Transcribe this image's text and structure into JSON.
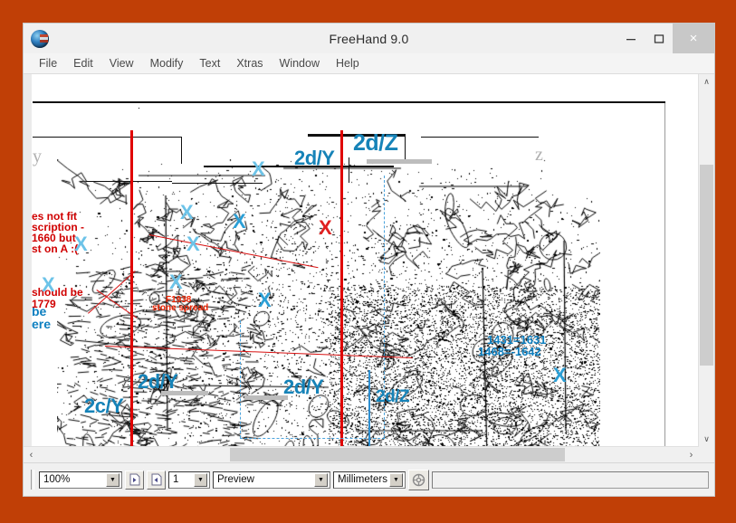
{
  "window": {
    "title": "FreeHand 9.0",
    "app_icon_name": "freehand-app-icon",
    "minimize_label": "–",
    "maximize_label": "❑",
    "close_label": "×"
  },
  "menu": {
    "items": [
      {
        "label": "File"
      },
      {
        "label": "Edit"
      },
      {
        "label": "View"
      },
      {
        "label": "Modify"
      },
      {
        "label": "Text"
      },
      {
        "label": "Xtras"
      },
      {
        "label": "Window"
      },
      {
        "label": "Help"
      }
    ]
  },
  "status_bar": {
    "zoom": {
      "value": "100%",
      "arrow": "▼"
    },
    "prev_page_icon": "previous-page-icon",
    "next_page_icon": "next-page-icon",
    "page": {
      "value": "1",
      "arrow": "▼"
    },
    "view_mode": {
      "value": "Preview",
      "arrow": "▼"
    },
    "units": {
      "value": "Millimeters",
      "arrow": "▼"
    },
    "animate_icon": "animation-wheel-icon",
    "message": ""
  },
  "scrollbars": {
    "vertical": {
      "up": "∧",
      "down": "∨"
    },
    "horizontal": {
      "left": "‹",
      "right": "›"
    }
  },
  "canvas": {
    "axis_labels": [
      {
        "text": "y"
      },
      {
        "text": "z"
      }
    ],
    "blue_labels": [
      {
        "text": "2d/Y"
      },
      {
        "text": "2d/Z"
      },
      {
        "text": "2d/Y"
      },
      {
        "text": "2c/Y"
      },
      {
        "text": "2d/Y"
      },
      {
        "text": "2d/Z"
      }
    ],
    "blue_note_lines": [
      {
        "text": "1431=1631"
      },
      {
        "text": "1468=-1642"
      }
    ],
    "blue_note_left": [
      {
        "text": "be"
      },
      {
        "text": "ere"
      }
    ],
    "red_note_1": [
      {
        "text": "es not fit"
      },
      {
        "text": "scription -"
      },
      {
        "text": "1660 but"
      },
      {
        "text": "st on A :("
      }
    ],
    "red_note_2": [
      {
        "text": "should be"
      },
      {
        "text": "1779"
      }
    ],
    "red_small": [
      {
        "text": "F1938"
      },
      {
        "text": "stone spread"
      }
    ],
    "x_marks": [
      {
        "text": "X"
      },
      {
        "text": "X"
      },
      {
        "text": "X"
      },
      {
        "text": "X"
      },
      {
        "text": "X"
      },
      {
        "text": "X"
      },
      {
        "text": "X"
      },
      {
        "text": "X"
      },
      {
        "text": "X"
      },
      {
        "text": "X"
      }
    ]
  },
  "colors": {
    "desktop": "#c03f06",
    "accent_blue": "#1683b8",
    "guide_red": "#e00000",
    "guide_blue": "#2f8fd0",
    "light_x": "#6cc3e8"
  }
}
